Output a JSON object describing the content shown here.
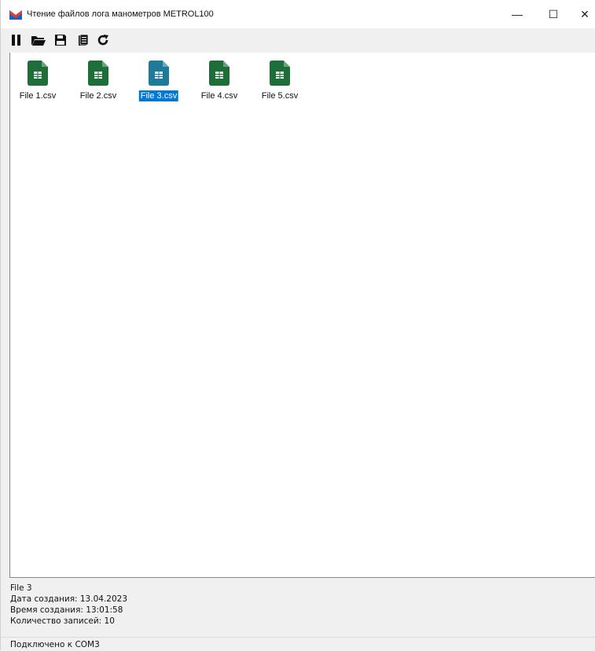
{
  "window": {
    "title": "Чтение файлов лога манометров METROL100",
    "controls": {
      "minimize": "—",
      "maximize": "☐",
      "close": "✕"
    }
  },
  "toolbar": {
    "buttons": [
      {
        "name": "pause",
        "icon": "pause-icon"
      },
      {
        "name": "open",
        "icon": "folder-open-icon"
      },
      {
        "name": "save",
        "icon": "floppy-disk-icon"
      },
      {
        "name": "copy",
        "icon": "document-copy-icon"
      },
      {
        "name": "refresh",
        "icon": "refresh-icon"
      }
    ]
  },
  "files": [
    {
      "label": "File 1.csv",
      "selected": false
    },
    {
      "label": "File 2.csv",
      "selected": false
    },
    {
      "label": "File 3.csv",
      "selected": true
    },
    {
      "label": "File 4.csv",
      "selected": false
    },
    {
      "label": "File 5.csv",
      "selected": false
    }
  ],
  "info": {
    "name": "File 3",
    "created_date": "Дата создания: 13.04.2023",
    "created_time": "Время создания: 13:01:58",
    "records": "Количество записей: 10"
  },
  "status": {
    "text": "Подключено к COM3"
  },
  "colors": {
    "file_icon": "#1e6e3a",
    "file_icon_selected": "#1d7a9a",
    "selection": "#0078d7"
  }
}
